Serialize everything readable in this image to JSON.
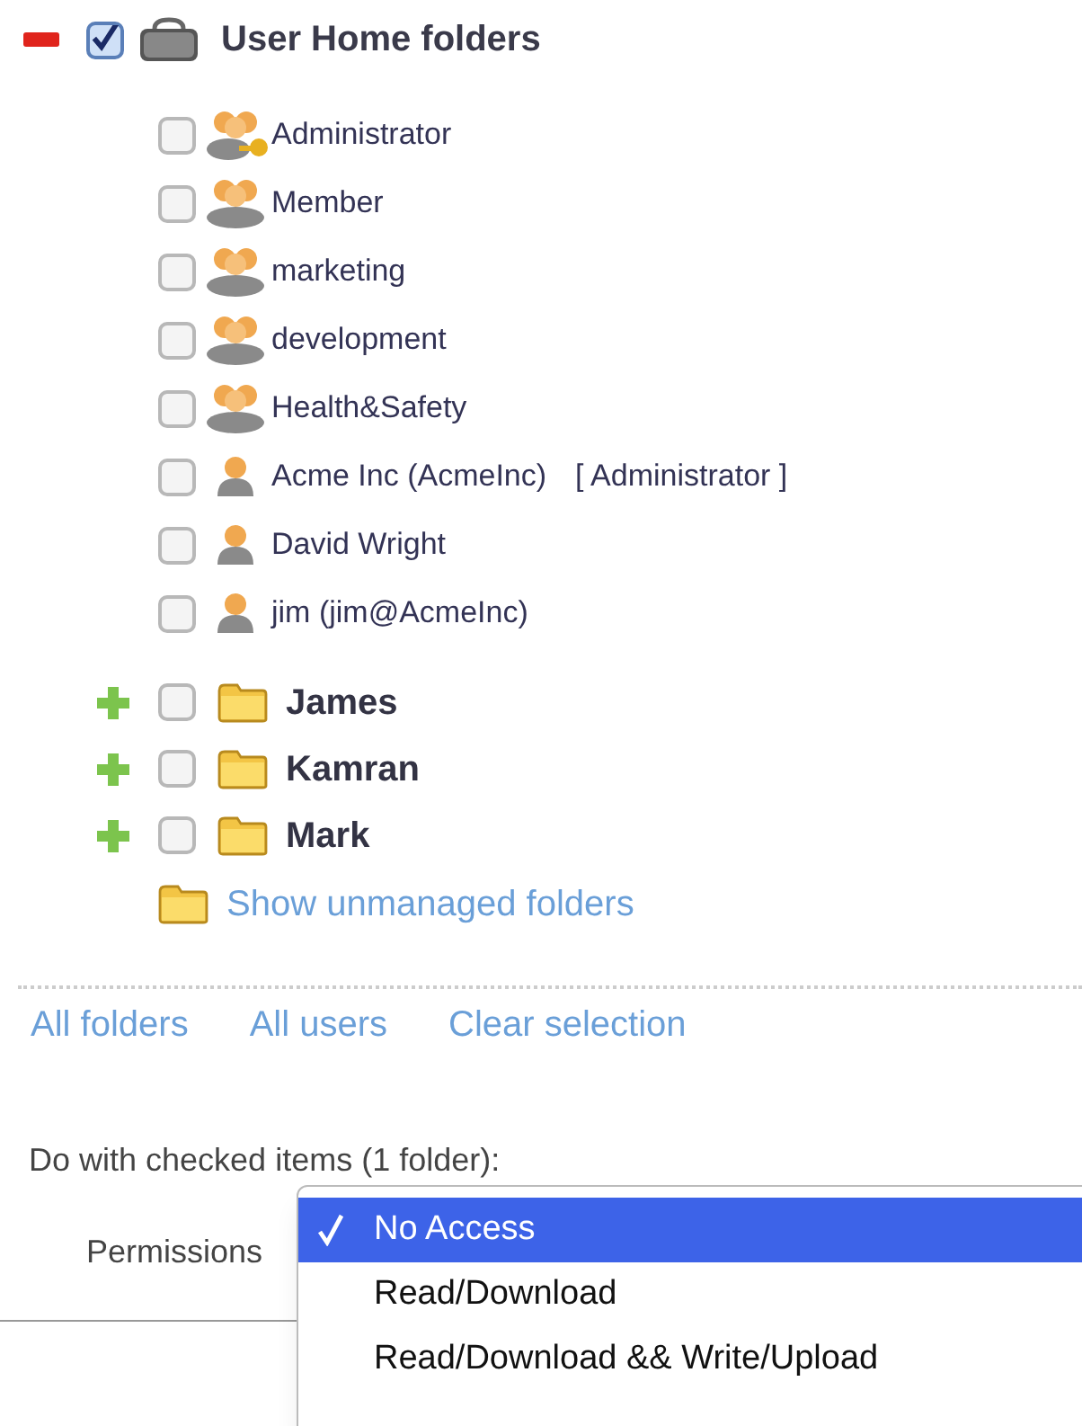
{
  "tree": {
    "label": "User Home folders",
    "expanded": true,
    "checked": true,
    "children": [
      {
        "kind": "admin_group",
        "label": "Administrator",
        "checked": false
      },
      {
        "kind": "group",
        "label": "Member",
        "checked": false
      },
      {
        "kind": "group",
        "label": "marketing",
        "checked": false
      },
      {
        "kind": "group",
        "label": "development",
        "checked": false
      },
      {
        "kind": "group",
        "label": "Health&Safety",
        "checked": false
      },
      {
        "kind": "user",
        "label": "Acme Inc (AcmeInc)",
        "role": "[ Administrator ]",
        "checked": false
      },
      {
        "kind": "user",
        "label": "David Wright",
        "checked": false
      },
      {
        "kind": "user",
        "label": "jim (jim@AcmeInc)",
        "checked": false
      }
    ],
    "folders": [
      {
        "label": "James",
        "expanded": false,
        "checked": false
      },
      {
        "label": "Kamran",
        "expanded": false,
        "checked": false
      },
      {
        "label": "Mark",
        "expanded": false,
        "checked": false
      }
    ],
    "unmanaged_link": "Show unmanaged folders"
  },
  "links": [
    "All folders",
    "All users",
    "Clear selection"
  ],
  "action_heading": "Do with checked items (1 folder):",
  "permissions_label": "Permissions",
  "permissions_menu": [
    {
      "label": "No Access",
      "selected": true
    },
    {
      "label": "Read/Download",
      "selected": false
    },
    {
      "label": "Read/Download && Write/Upload",
      "selected": false
    }
  ]
}
